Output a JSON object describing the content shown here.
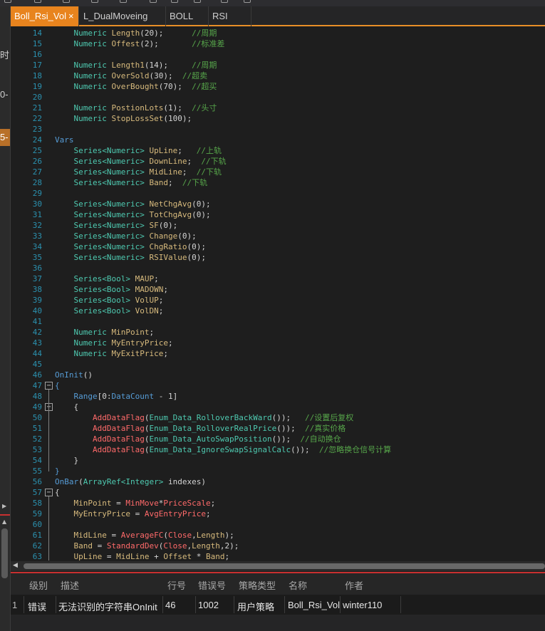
{
  "tabs": [
    {
      "label": "Boll_Rsi_Vol",
      "active": true,
      "close": "×"
    },
    {
      "label": "L_DualMoveing"
    },
    {
      "label": "BOLL"
    },
    {
      "label": "RSI"
    }
  ],
  "left_strip": {
    "text_1": "时",
    "text_2": "0-",
    "text_3": "5-"
  },
  "code_lines": [
    {
      "n": "14",
      "t": [
        [
          "",
          "    "
        ],
        [
          "ty",
          "Numeric"
        ],
        [
          "id",
          " Length"
        ],
        [
          "pl",
          "(20);      "
        ],
        [
          "cm",
          "//周期"
        ]
      ]
    },
    {
      "n": "15",
      "t": [
        [
          "",
          "    "
        ],
        [
          "ty",
          "Numeric"
        ],
        [
          "id",
          " Offest"
        ],
        [
          "pl",
          "(2);       "
        ],
        [
          "cm",
          "//标准差"
        ]
      ]
    },
    {
      "n": "16",
      "t": []
    },
    {
      "n": "17",
      "t": [
        [
          "",
          "    "
        ],
        [
          "ty",
          "Numeric"
        ],
        [
          "id",
          " Length1"
        ],
        [
          "pl",
          "(14);     "
        ],
        [
          "cm",
          "//周期"
        ]
      ]
    },
    {
      "n": "18",
      "t": [
        [
          "",
          "    "
        ],
        [
          "ty",
          "Numeric"
        ],
        [
          "id",
          " OverSold"
        ],
        [
          "pl",
          "(30);  "
        ],
        [
          "cm",
          "//超卖"
        ]
      ]
    },
    {
      "n": "19",
      "t": [
        [
          "",
          "    "
        ],
        [
          "ty",
          "Numeric"
        ],
        [
          "id",
          " OverBought"
        ],
        [
          "pl",
          "(70);  "
        ],
        [
          "cm",
          "//超买"
        ]
      ]
    },
    {
      "n": "20",
      "t": []
    },
    {
      "n": "21",
      "t": [
        [
          "",
          "    "
        ],
        [
          "ty",
          "Numeric"
        ],
        [
          "id",
          " PostionLots"
        ],
        [
          "pl",
          "(1);  "
        ],
        [
          "cm",
          "//头寸"
        ]
      ]
    },
    {
      "n": "22",
      "t": [
        [
          "",
          "    "
        ],
        [
          "ty",
          "Numeric"
        ],
        [
          "id",
          " StopLossSet"
        ],
        [
          "pl",
          "(100);"
        ]
      ]
    },
    {
      "n": "23",
      "t": []
    },
    {
      "n": "24",
      "t": [
        [
          "kw",
          "Vars"
        ]
      ]
    },
    {
      "n": "25",
      "t": [
        [
          "",
          "    "
        ],
        [
          "ty",
          "Series<Numeric>"
        ],
        [
          "id",
          " UpLine"
        ],
        [
          "pl",
          ";   "
        ],
        [
          "cm",
          "//上轨"
        ]
      ]
    },
    {
      "n": "26",
      "t": [
        [
          "",
          "    "
        ],
        [
          "ty",
          "Series<Numeric>"
        ],
        [
          "id",
          " DownLine"
        ],
        [
          "pl",
          ";  "
        ],
        [
          "cm",
          "//下轨"
        ]
      ]
    },
    {
      "n": "27",
      "t": [
        [
          "",
          "    "
        ],
        [
          "ty",
          "Series<Numeric>"
        ],
        [
          "id",
          " MidLine"
        ],
        [
          "pl",
          ";  "
        ],
        [
          "cm",
          "//下轨"
        ]
      ]
    },
    {
      "n": "28",
      "t": [
        [
          "",
          "    "
        ],
        [
          "ty",
          "Series<Numeric>"
        ],
        [
          "id",
          " Band"
        ],
        [
          "pl",
          ";  "
        ],
        [
          "cm",
          "//下轨"
        ]
      ]
    },
    {
      "n": "29",
      "t": []
    },
    {
      "n": "30",
      "t": [
        [
          "",
          "    "
        ],
        [
          "ty",
          "Series<Numeric>"
        ],
        [
          "id",
          " NetChgAvg"
        ],
        [
          "pl",
          "(0);"
        ]
      ]
    },
    {
      "n": "31",
      "t": [
        [
          "",
          "    "
        ],
        [
          "ty",
          "Series<Numeric>"
        ],
        [
          "id",
          " TotChgAvg"
        ],
        [
          "pl",
          "(0);"
        ]
      ]
    },
    {
      "n": "32",
      "t": [
        [
          "",
          "    "
        ],
        [
          "ty",
          "Series<Numeric>"
        ],
        [
          "id",
          " SF"
        ],
        [
          "pl",
          "(0);"
        ]
      ]
    },
    {
      "n": "33",
      "t": [
        [
          "",
          "    "
        ],
        [
          "ty",
          "Series<Numeric>"
        ],
        [
          "id",
          " Change"
        ],
        [
          "pl",
          "(0);"
        ]
      ]
    },
    {
      "n": "34",
      "t": [
        [
          "",
          "    "
        ],
        [
          "ty",
          "Series<Numeric>"
        ],
        [
          "id",
          " ChgRatio"
        ],
        [
          "pl",
          "(0);"
        ]
      ]
    },
    {
      "n": "35",
      "t": [
        [
          "",
          "    "
        ],
        [
          "ty",
          "Series<Numeric>"
        ],
        [
          "id",
          " RSIValue"
        ],
        [
          "pl",
          "(0);"
        ]
      ]
    },
    {
      "n": "36",
      "t": []
    },
    {
      "n": "37",
      "t": [
        [
          "",
          "    "
        ],
        [
          "ty",
          "Series<Bool>"
        ],
        [
          "id",
          " MAUP"
        ],
        [
          "pl",
          ";"
        ]
      ]
    },
    {
      "n": "38",
      "t": [
        [
          "",
          "    "
        ],
        [
          "ty",
          "Series<Bool>"
        ],
        [
          "id",
          " MADOWN"
        ],
        [
          "pl",
          ";"
        ]
      ]
    },
    {
      "n": "39",
      "t": [
        [
          "",
          "    "
        ],
        [
          "ty",
          "Series<Bool>"
        ],
        [
          "id",
          " VolUP"
        ],
        [
          "pl",
          ";"
        ]
      ]
    },
    {
      "n": "40",
      "t": [
        [
          "",
          "    "
        ],
        [
          "ty",
          "Series<Bool>"
        ],
        [
          "id",
          " VolDN"
        ],
        [
          "pl",
          ";"
        ]
      ]
    },
    {
      "n": "41",
      "t": []
    },
    {
      "n": "42",
      "t": [
        [
          "",
          "    "
        ],
        [
          "ty",
          "Numeric"
        ],
        [
          "id",
          " MinPoint"
        ],
        [
          "pl",
          ";"
        ]
      ]
    },
    {
      "n": "43",
      "t": [
        [
          "",
          "    "
        ],
        [
          "ty",
          "Numeric"
        ],
        [
          "id",
          " MyEntryPrice"
        ],
        [
          "pl",
          ";"
        ]
      ]
    },
    {
      "n": "44",
      "t": [
        [
          "",
          "    "
        ],
        [
          "ty",
          "Numeric"
        ],
        [
          "id",
          " MyExitPrice"
        ],
        [
          "pl",
          ";"
        ]
      ]
    },
    {
      "n": "45",
      "t": []
    },
    {
      "n": "46",
      "t": [
        [
          "kw",
          "OnInit"
        ],
        [
          "pl",
          "()"
        ]
      ]
    },
    {
      "n": "47",
      "fold": "−",
      "t": [
        [
          "kw",
          "{"
        ]
      ]
    },
    {
      "n": "48",
      "t": [
        [
          "",
          "    "
        ],
        [
          "kw",
          "Range"
        ],
        [
          "pl",
          "[0:"
        ],
        [
          "kw",
          "DataCount"
        ],
        [
          "pl",
          " - 1]"
        ]
      ]
    },
    {
      "n": "49",
      "fold": "−",
      "t": [
        [
          "",
          "    "
        ],
        [
          "pl",
          "{"
        ]
      ]
    },
    {
      "n": "50",
      "t": [
        [
          "",
          "        "
        ],
        [
          "fn",
          "AddDataFlag"
        ],
        [
          "pl",
          "("
        ],
        [
          "ty",
          "Enum_Data_RolloverBackWard"
        ],
        [
          "pl",
          "());   "
        ],
        [
          "cm",
          "//设置后复权"
        ]
      ]
    },
    {
      "n": "51",
      "t": [
        [
          "",
          "        "
        ],
        [
          "fn",
          "AddDataFlag"
        ],
        [
          "pl",
          "("
        ],
        [
          "ty",
          "Enum_Data_RolloverRealPrice"
        ],
        [
          "pl",
          "());  "
        ],
        [
          "cm",
          "//真实价格"
        ]
      ]
    },
    {
      "n": "52",
      "t": [
        [
          "",
          "        "
        ],
        [
          "fn",
          "AddDataFlag"
        ],
        [
          "pl",
          "("
        ],
        [
          "ty",
          "Enum_Data_AutoSwapPosition"
        ],
        [
          "pl",
          "());  "
        ],
        [
          "cm",
          "//自动换仓"
        ]
      ]
    },
    {
      "n": "53",
      "t": [
        [
          "",
          "        "
        ],
        [
          "fn",
          "AddDataFlag"
        ],
        [
          "pl",
          "("
        ],
        [
          "ty",
          "Enum_Data_IgnoreSwapSignalCalc"
        ],
        [
          "pl",
          "());  "
        ],
        [
          "cm",
          "//忽略换仓信号计算"
        ]
      ]
    },
    {
      "n": "54",
      "t": [
        [
          "",
          "    "
        ],
        [
          "pl",
          "}"
        ]
      ]
    },
    {
      "n": "55",
      "t": [
        [
          "kw",
          "}"
        ]
      ]
    },
    {
      "n": "56",
      "t": [
        [
          "kw",
          "OnBar"
        ],
        [
          "pl",
          "("
        ],
        [
          "ty",
          "ArrayRef<Integer>"
        ],
        [
          "pl",
          " indexes)"
        ]
      ]
    },
    {
      "n": "57",
      "fold": "−",
      "t": [
        [
          "pl",
          "{"
        ]
      ]
    },
    {
      "n": "58",
      "t": [
        [
          "",
          "    "
        ],
        [
          "id",
          "MinPoint"
        ],
        [
          "pl",
          " = "
        ],
        [
          "fn",
          "MinMove"
        ],
        [
          "pl",
          "*"
        ],
        [
          "fn",
          "PriceScale"
        ],
        [
          "pl",
          ";"
        ]
      ]
    },
    {
      "n": "59",
      "t": [
        [
          "",
          "    "
        ],
        [
          "id",
          "MyEntryPrice"
        ],
        [
          "pl",
          " = "
        ],
        [
          "fn",
          "AvgEntryPrice"
        ],
        [
          "pl",
          ";"
        ]
      ]
    },
    {
      "n": "60",
      "t": []
    },
    {
      "n": "61",
      "t": [
        [
          "",
          "    "
        ],
        [
          "id",
          "MidLine"
        ],
        [
          "pl",
          " = "
        ],
        [
          "fn",
          "AverageFC"
        ],
        [
          "pl",
          "("
        ],
        [
          "fn",
          "Close"
        ],
        [
          "pl",
          ","
        ],
        [
          "id",
          "Length"
        ],
        [
          "pl",
          ");"
        ]
      ]
    },
    {
      "n": "62",
      "t": [
        [
          "",
          "    "
        ],
        [
          "id",
          "Band"
        ],
        [
          "pl",
          " = "
        ],
        [
          "fn",
          "StandardDev"
        ],
        [
          "pl",
          "("
        ],
        [
          "fn",
          "Close"
        ],
        [
          "pl",
          ","
        ],
        [
          "id",
          "Length"
        ],
        [
          "pl",
          ",2);"
        ]
      ]
    },
    {
      "n": "63",
      "t": [
        [
          "",
          "    "
        ],
        [
          "id",
          "UpLine"
        ],
        [
          "pl",
          " = "
        ],
        [
          "id",
          "MidLine"
        ],
        [
          "pl",
          " + "
        ],
        [
          "id",
          "Offset"
        ],
        [
          "pl",
          " * "
        ],
        [
          "id",
          "Band"
        ],
        [
          "pl",
          ";"
        ]
      ]
    }
  ],
  "error_panel": {
    "columns": [
      "级别",
      "描述",
      "行号",
      "错误号",
      "策略类型",
      "名称",
      "作者"
    ],
    "rows": [
      {
        "index": "1",
        "level": "错误",
        "description": "无法识别的字符串OnInit",
        "line": "46",
        "code": "1002",
        "type": "用户策略",
        "name": "Boll_Rsi_Vol",
        "author": "winter110"
      }
    ]
  }
}
